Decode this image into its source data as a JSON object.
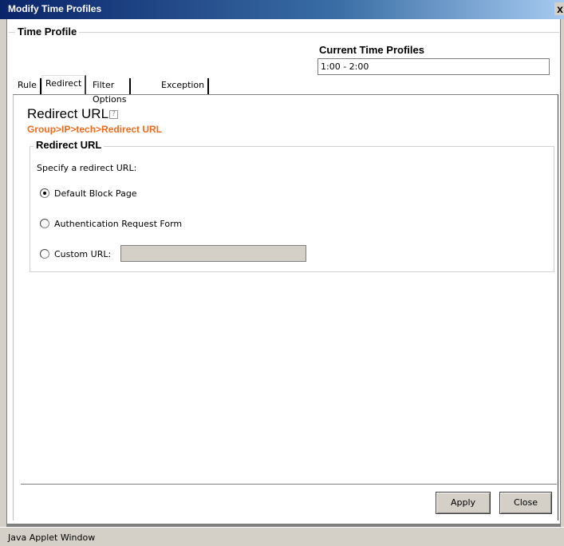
{
  "window": {
    "title": "Modify Time Profiles",
    "close_glyph": "x"
  },
  "time_profile": {
    "legend": "Time Profile",
    "current_label": "Current Time Profiles",
    "current_value": "1:00 - 2:00"
  },
  "tabs": [
    {
      "label": "Rule",
      "active": false
    },
    {
      "label": "Redirect",
      "active": true
    },
    {
      "label": "Filter Options",
      "active": false
    },
    {
      "label": "Exception",
      "active": false
    }
  ],
  "redirect": {
    "title": "Redirect URL",
    "help_glyph": "?",
    "breadcrumb": "Group>IP>tech>Redirect URL",
    "group_legend": "Redirect URL",
    "specify_label": "Specify a redirect URL:",
    "options": [
      {
        "label": "Default Block Page",
        "checked": true
      },
      {
        "label": "Authentication Request Form",
        "checked": false
      },
      {
        "label": "Custom URL:",
        "checked": false
      }
    ],
    "custom_url_value": ""
  },
  "buttons": {
    "apply": "Apply",
    "close": "Close"
  },
  "status": {
    "text": "Java Applet Window"
  },
  "colors": {
    "breadcrumb": "#f26a1b",
    "titlebar": "#0a246a",
    "chrome": "#d4d0c8"
  },
  "icons": {
    "help": "help-icon",
    "close": "close-icon"
  }
}
